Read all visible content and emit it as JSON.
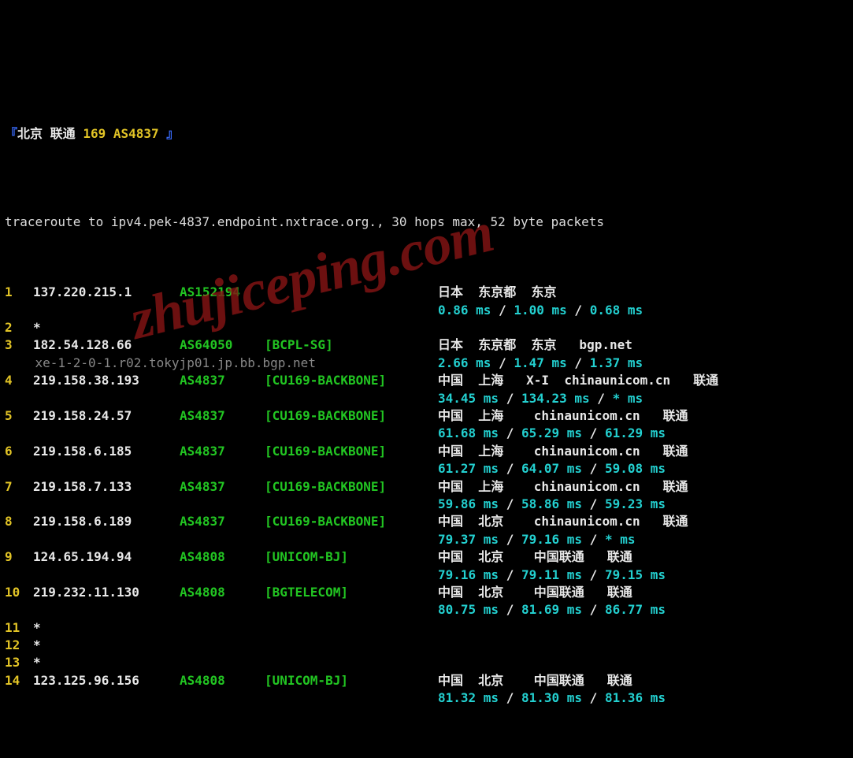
{
  "header": {
    "bracket_open": "『",
    "bracket_close": " 』",
    "title_cn_a": "北京",
    "title_cn_b": " 联通 ",
    "code169": "169",
    "as_label": " AS4837"
  },
  "intro": "traceroute to ipv4.pek-4837.endpoint.nxtrace.org., 30 hops max, 52 byte packets",
  "hops": [
    {
      "n": "1",
      "ip": "137.220.215.1",
      "asn": "AS152194",
      "tag": "",
      "loc": "日本  东京都  东京",
      "extra": "",
      "rdns": "",
      "rtt": [
        "0.86 ms",
        "1.00 ms",
        "0.68 ms"
      ]
    },
    {
      "n": "2",
      "ip": "*",
      "asn": "",
      "tag": "",
      "loc": "",
      "rtt": null
    },
    {
      "n": "3",
      "ip": "182.54.128.66",
      "asn": "AS64050",
      "tag": "[BCPL-SG]",
      "loc": "日本  东京都  东京   bgp.net",
      "rdns": "xe-1-2-0-1.r02.tokyjp01.jp.bb.bgp.net",
      "rtt": [
        "2.66 ms",
        "1.47 ms",
        "1.37 ms"
      ]
    },
    {
      "n": "4",
      "ip": "219.158.38.193",
      "asn": "AS4837",
      "tag": "[CU169-BACKBONE]",
      "loc": "中国  上海   X-I  chinaunicom.cn   联通",
      "rtt": [
        "34.45 ms",
        "134.23 ms",
        "* ms"
      ]
    },
    {
      "n": "5",
      "ip": "219.158.24.57",
      "asn": "AS4837",
      "tag": "[CU169-BACKBONE]",
      "loc": "中国  上海    chinaunicom.cn   联通",
      "rtt": [
        "61.68 ms",
        "65.29 ms",
        "61.29 ms"
      ]
    },
    {
      "n": "6",
      "ip": "219.158.6.185",
      "asn": "AS4837",
      "tag": "[CU169-BACKBONE]",
      "loc": "中国  上海    chinaunicom.cn   联通",
      "rtt": [
        "61.27 ms",
        "64.07 ms",
        "59.08 ms"
      ]
    },
    {
      "n": "7",
      "ip": "219.158.7.133",
      "asn": "AS4837",
      "tag": "[CU169-BACKBONE]",
      "loc": "中国  上海    chinaunicom.cn   联通",
      "rtt": [
        "59.86 ms",
        "58.86 ms",
        "59.23 ms"
      ]
    },
    {
      "n": "8",
      "ip": "219.158.6.189",
      "asn": "AS4837",
      "tag": "[CU169-BACKBONE]",
      "loc": "中国  北京    chinaunicom.cn   联通",
      "rtt": [
        "79.37 ms",
        "79.16 ms",
        "* ms"
      ]
    },
    {
      "n": "9",
      "ip": "124.65.194.94",
      "asn": "AS4808",
      "tag": "[UNICOM-BJ]",
      "loc": "中国  北京    中国联通   联通",
      "rtt": [
        "79.16 ms",
        "79.11 ms",
        "79.15 ms"
      ]
    },
    {
      "n": "10",
      "ip": "219.232.11.130",
      "asn": "AS4808",
      "tag": "[BGTELECOM]",
      "loc": "中国  北京    中国联通   联通",
      "rtt": [
        "80.75 ms",
        "81.69 ms",
        "86.77 ms"
      ]
    },
    {
      "n": "11",
      "ip": "*",
      "asn": "",
      "tag": "",
      "loc": "",
      "rtt": null
    },
    {
      "n": "12",
      "ip": "*",
      "asn": "",
      "tag": "",
      "loc": "",
      "rtt": null
    },
    {
      "n": "13",
      "ip": "*",
      "asn": "",
      "tag": "",
      "loc": "",
      "rtt": null
    },
    {
      "n": "14",
      "ip": "123.125.96.156",
      "asn": "AS4808",
      "tag": "[UNICOM-BJ]",
      "loc": "中国  北京    中国联通   联通",
      "rtt": [
        "81.32 ms",
        "81.30 ms",
        "81.36 ms"
      ]
    }
  ],
  "sep": " / ",
  "watermark": "zhujiceping.com"
}
